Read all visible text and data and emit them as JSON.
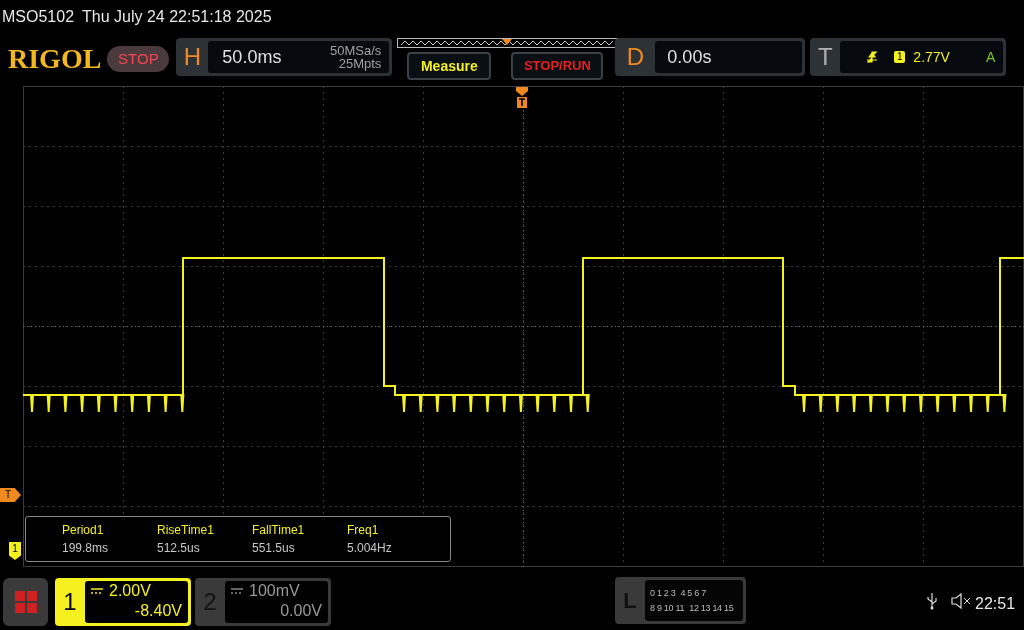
{
  "title_bar": {
    "model": "MSO5102",
    "datetime": "Thu July 24 22:51:18 2025"
  },
  "toolbar": {
    "logo": "RIGOL",
    "run_state": "STOP",
    "horizontal": {
      "label": "H",
      "timebase": "50.0ms",
      "sample_rate": "50MSa/s",
      "memory_depth": "25Mpts"
    },
    "buttons": [
      "Measure",
      "STOP/RUN"
    ],
    "delay": {
      "label": "D",
      "value": "0.00s"
    },
    "trigger": {
      "label": "T",
      "source": "1",
      "level": "2.77V",
      "mode": "A"
    }
  },
  "markers": {
    "trigger_level": "T",
    "channel": "1"
  },
  "measurements": [
    {
      "name": "Period1",
      "value": "199.8ms"
    },
    {
      "name": "RiseTime1",
      "value": "512.5us"
    },
    {
      "name": "FallTime1",
      "value": "551.5us"
    },
    {
      "name": "Freq1",
      "value": "5.004Hz"
    }
  ],
  "channels": [
    {
      "number": "1",
      "scale": "2.00V",
      "offset": "-8.40V",
      "selected": true
    },
    {
      "number": "2",
      "scale": "100mV",
      "offset": "0.00V",
      "selected": false
    }
  ],
  "logic": {
    "label": "L",
    "row_1": [
      "0 1 2 3",
      "4 5 6 7"
    ],
    "row_2": [
      "8 9 10 11",
      "12 13 14 15"
    ]
  },
  "status": {
    "time": "22:51"
  }
}
